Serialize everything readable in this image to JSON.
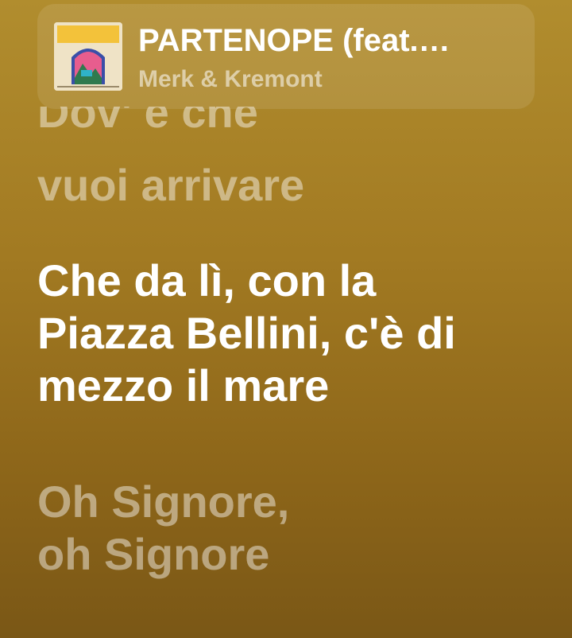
{
  "now_playing": {
    "title": "PARTENOPE (feat.…",
    "artist": "Merk & Kremont",
    "artwork_icon": "album-art"
  },
  "lyrics": {
    "previous_partial": "Dov' è che",
    "previous": "vuoi arrivare",
    "current_lines": [
      "Che da lì, con la",
      "Piazza Bellini, c'è di",
      "mezzo il mare"
    ],
    "next_lines": [
      "Oh Signore,",
      "oh Signore"
    ]
  },
  "colors": {
    "background_top": "#b18d2e",
    "background_bottom": "#7a5716",
    "active_text": "#ffffff",
    "inactive_text": "rgba(255,255,255,0.45)"
  }
}
